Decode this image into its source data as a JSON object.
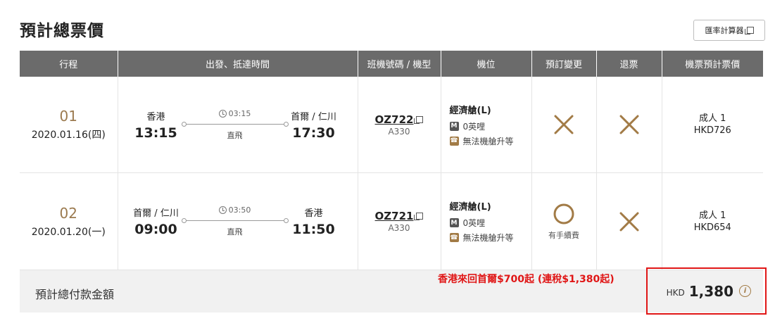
{
  "title": "預計總票價",
  "calc_button": {
    "label": "匯率計算器",
    "icon": "external-window-icon"
  },
  "columns": [
    "行程",
    "出發、抵達時間",
    "班機號碼 / 機型",
    "機位",
    "預訂變更",
    "退票",
    "機票預計票價"
  ],
  "segments": [
    {
      "no": "01",
      "date": "2020.01.16(四)",
      "depart_city": "香港",
      "depart_time": "13:15",
      "duration": "03:15",
      "direct": "直飛",
      "arrive_city": "首爾 / 仁川",
      "arrive_time": "17:30",
      "flight": "OZ722",
      "aircraft": "A330",
      "cabin": "經濟艙(L)",
      "mileage": "0英哩",
      "upgrade": "無法機艙升等",
      "change": {
        "symbol": "cross",
        "note": ""
      },
      "refund": {
        "symbol": "cross",
        "note": ""
      },
      "pax": "成人 1",
      "price": "HKD726"
    },
    {
      "no": "02",
      "date": "2020.01.20(一)",
      "depart_city": "首爾 / 仁川",
      "depart_time": "09:00",
      "duration": "03:50",
      "direct": "直飛",
      "arrive_city": "香港",
      "arrive_time": "11:50",
      "flight": "OZ721",
      "aircraft": "A330",
      "cabin": "經濟艙(L)",
      "mileage": "0英哩",
      "upgrade": "無法機艙升等",
      "change": {
        "symbol": "circle",
        "note": "有手續費"
      },
      "refund": {
        "symbol": "cross",
        "note": ""
      },
      "pax": "成人 1",
      "price": "HKD654"
    }
  ],
  "total": {
    "label": "預計總付款金額",
    "currency": "HKD",
    "amount": "1,380"
  },
  "promo": "香港來回首爾$700起 (連稅$1,380起)",
  "colors": {
    "header_bg": "#6b6b6b",
    "accent_gold": "#9b7a4f",
    "highlight_red": "#e01616"
  }
}
